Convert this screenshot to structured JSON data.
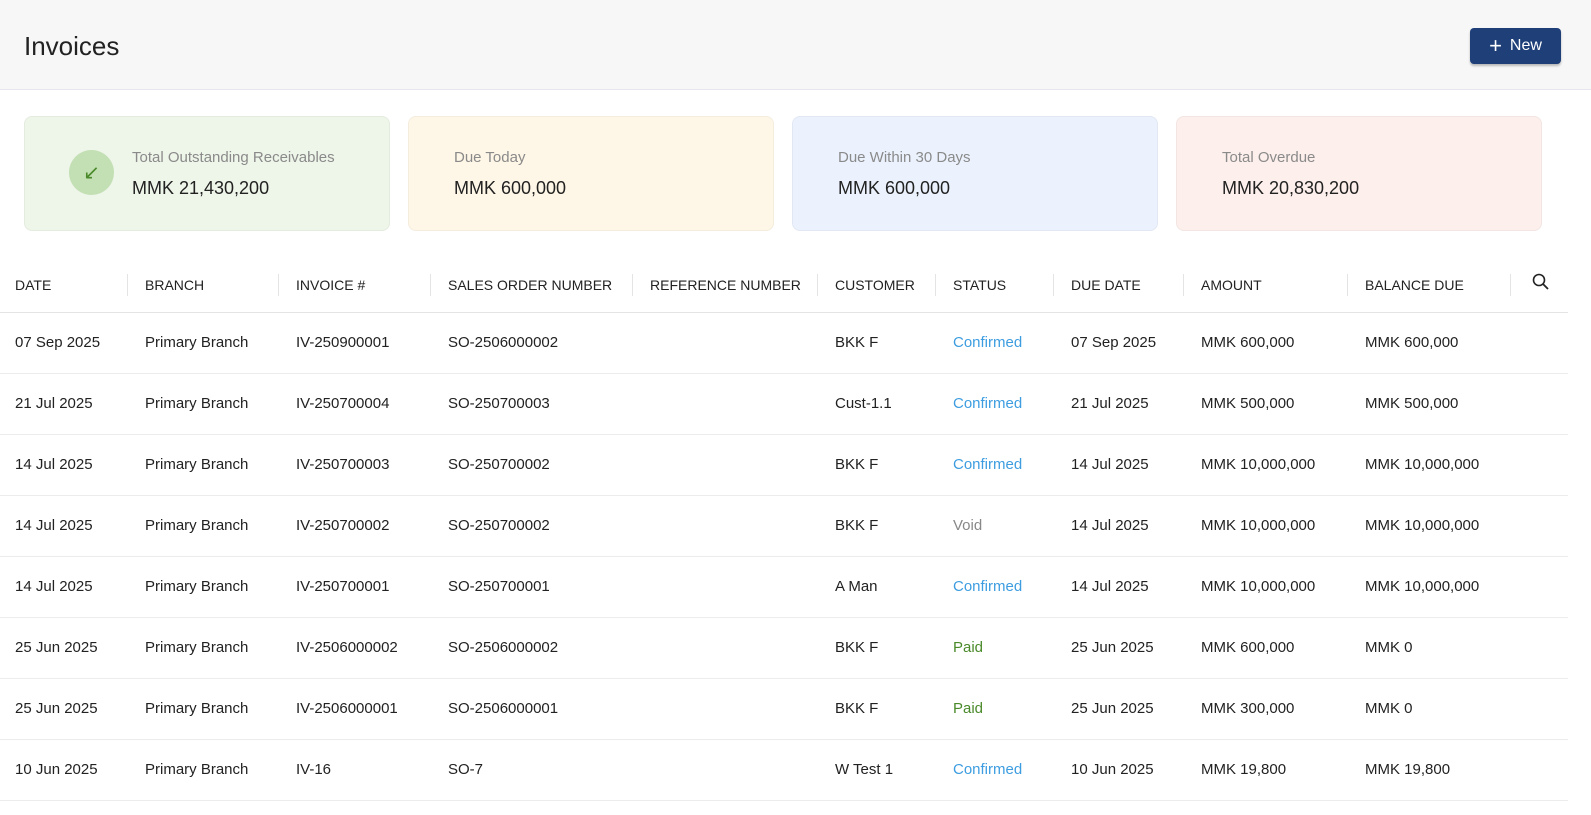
{
  "header": {
    "title": "Invoices",
    "new_label": "New"
  },
  "cards": [
    {
      "label": "Total Outstanding Receivables",
      "value": "MMK 21,430,200",
      "bg": "#eef5e9"
    },
    {
      "label": "Due Today",
      "value": "MMK 600,000",
      "bg": "#fef6e6"
    },
    {
      "label": "Due Within 30 Days",
      "value": "MMK 600,000",
      "bg": "#ebf2fd"
    },
    {
      "label": "Total Overdue",
      "value": "MMK 20,830,200",
      "bg": "#fdefeb"
    }
  ],
  "table": {
    "columns": [
      "DATE",
      "BRANCH",
      "INVOICE #",
      "SALES ORDER NUMBER",
      "REFERENCE NUMBER",
      "CUSTOMER",
      "STATUS",
      "DUE DATE",
      "AMOUNT",
      "BALANCE DUE"
    ],
    "rows": [
      [
        "07 Sep 2025",
        "Primary Branch",
        "IV-250900001",
        "SO-2506000002",
        "",
        "BKK F",
        "Confirmed",
        "07 Sep 2025",
        "MMK 600,000",
        "MMK 600,000"
      ],
      [
        "21 Jul 2025",
        "Primary Branch",
        "IV-250700004",
        "SO-250700003",
        "",
        "Cust-1.1",
        "Confirmed",
        "21 Jul 2025",
        "MMK 500,000",
        "MMK 500,000"
      ],
      [
        "14 Jul 2025",
        "Primary Branch",
        "IV-250700003",
        "SO-250700002",
        "",
        "BKK F",
        "Confirmed",
        "14 Jul 2025",
        "MMK 10,000,000",
        "MMK 10,000,000"
      ],
      [
        "14 Jul 2025",
        "Primary Branch",
        "IV-250700002",
        "SO-250700002",
        "",
        "BKK F",
        "Void",
        "14 Jul 2025",
        "MMK 10,000,000",
        "MMK 10,000,000"
      ],
      [
        "14 Jul 2025",
        "Primary Branch",
        "IV-250700001",
        "SO-250700001",
        "",
        "A Man",
        "Confirmed",
        "14 Jul 2025",
        "MMK 10,000,000",
        "MMK 10,000,000"
      ],
      [
        "25 Jun 2025",
        "Primary Branch",
        "IV-2506000002",
        "SO-2506000002",
        "",
        "BKK F",
        "Paid",
        "25 Jun 2025",
        "MMK 600,000",
        "MMK 0"
      ],
      [
        "25 Jun 2025",
        "Primary Branch",
        "IV-2506000001",
        "SO-2506000001",
        "",
        "BKK F",
        "Paid",
        "25 Jun 2025",
        "MMK 300,000",
        "MMK 0"
      ],
      [
        "10 Jun 2025",
        "Primary Branch",
        "IV-16",
        "SO-7",
        "",
        "W Test 1",
        "Confirmed",
        "10 Jun 2025",
        "MMK 19,800",
        "MMK 19,800"
      ]
    ]
  }
}
